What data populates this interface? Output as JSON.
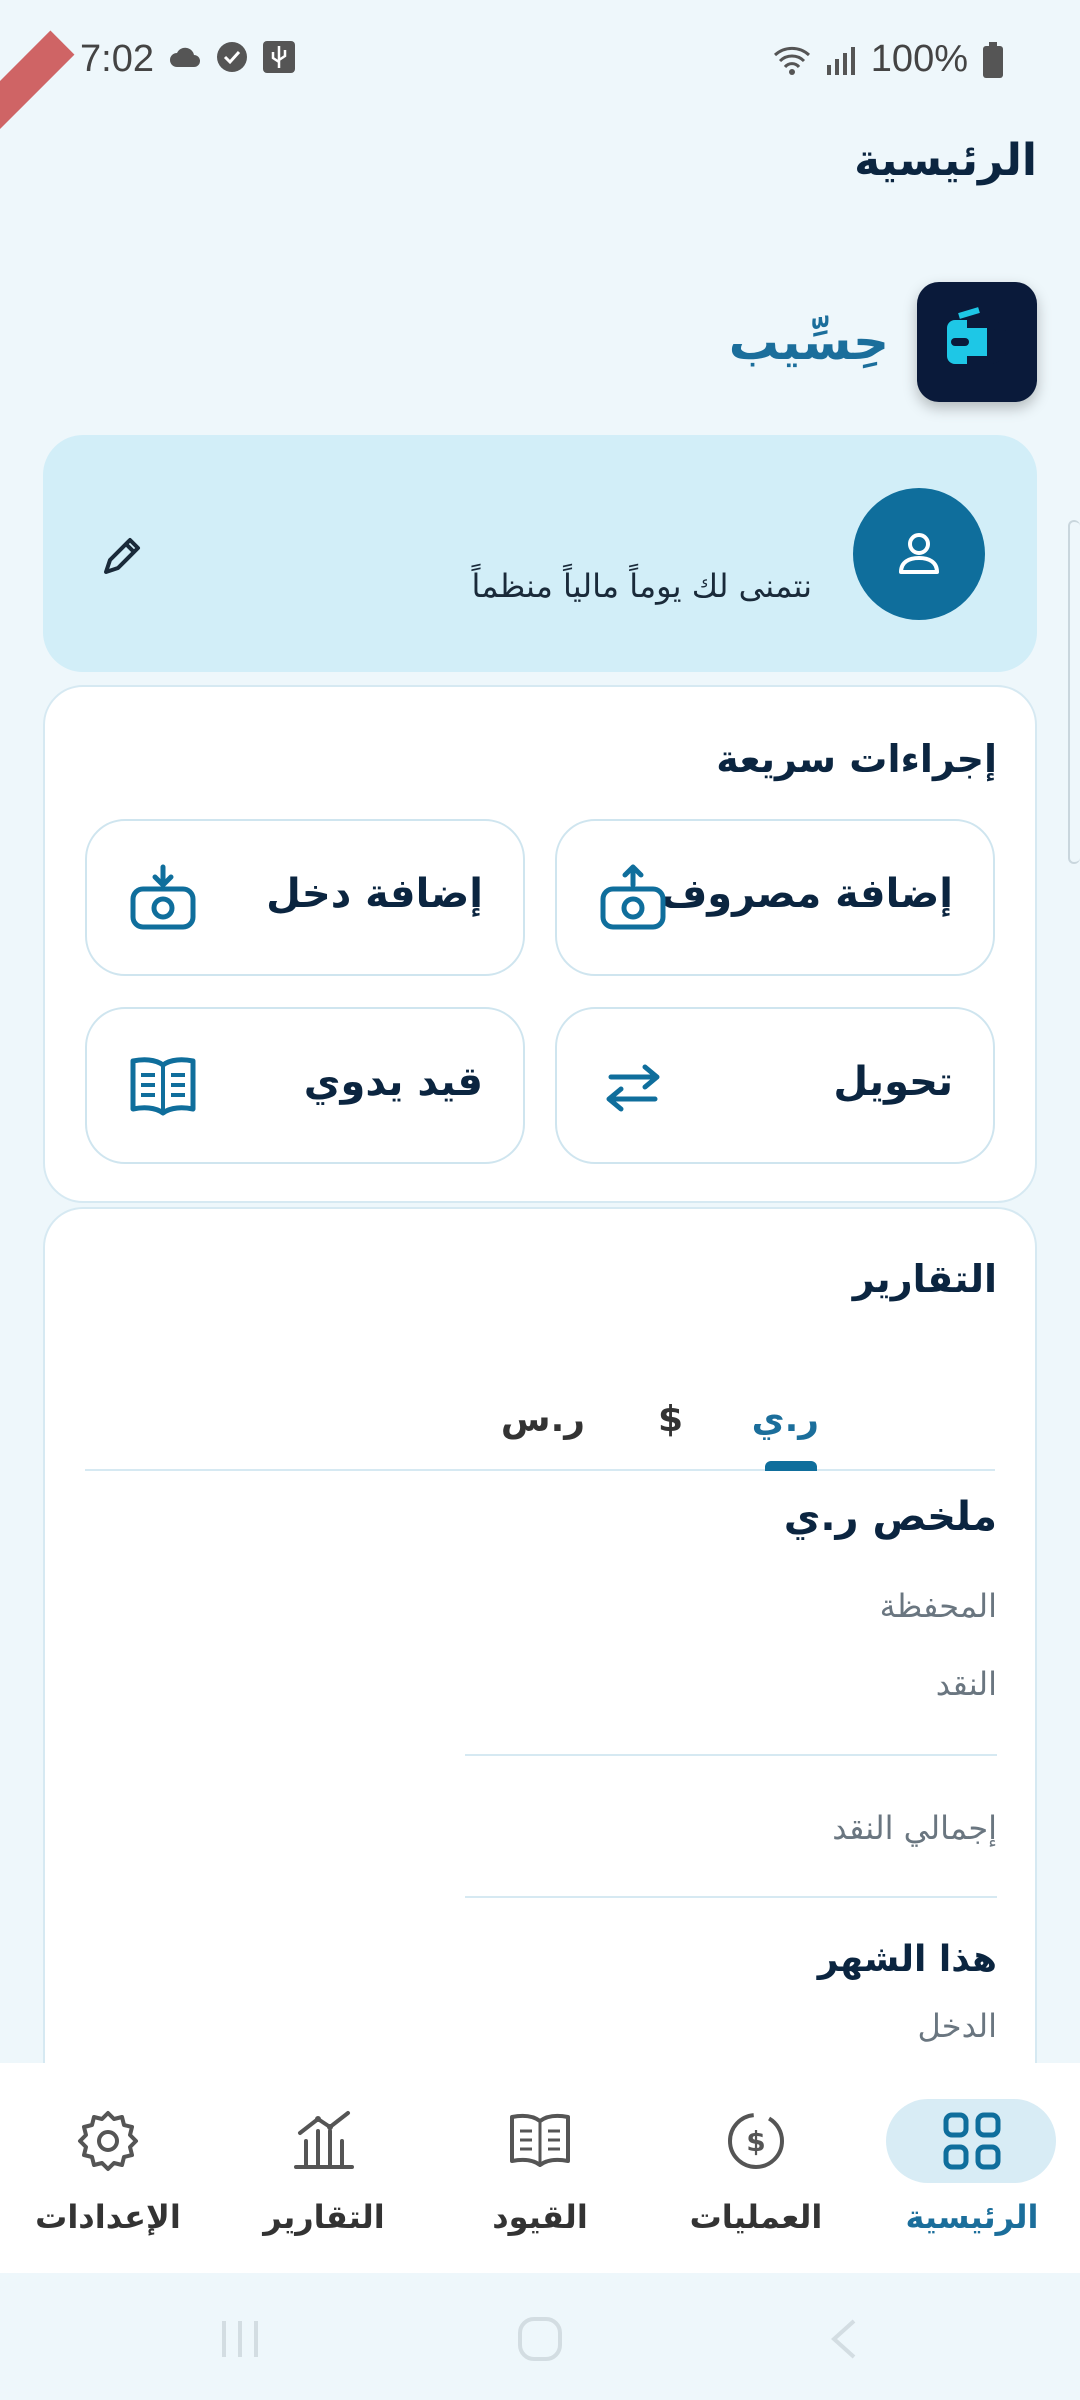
{
  "status_bar": {
    "time": "7:02",
    "battery": "100%"
  },
  "header": {
    "title": "الرئيسية"
  },
  "brand": {
    "name": "حِسِّيب"
  },
  "greeting": {
    "text": "نتمنى لك يوماً مالياً منظماً"
  },
  "quick_actions": {
    "title": "إجراءات سريعة",
    "add_expense": "إضافة مصروف",
    "add_income": "إضافة دخل",
    "transfer": "تحويل",
    "manual_entry": "قيد يدوي"
  },
  "reports": {
    "title": "التقارير",
    "tabs": [
      "ر.ي",
      "$",
      "ر.س"
    ],
    "active_tab": "ر.ي",
    "summary_title": "ملخص ر.ي",
    "rows": [
      "المحفظة",
      "النقد"
    ],
    "total_label": "إجمالي النقد",
    "month_title": "هذا الشهر",
    "month_rows": [
      "الدخل"
    ]
  },
  "bottom_nav": {
    "home": "الرئيسية",
    "transactions": "العمليات",
    "entries": "القيود",
    "reports": "التقارير",
    "settings": "الإعدادات"
  },
  "colors": {
    "accent": "#0f6e9c",
    "greeting_bg": "#d2eef8",
    "page_bg": "#eef7fb"
  },
  "icons": [
    "cloud-icon",
    "check-circle-icon",
    "usb-icon",
    "wifi-icon",
    "signal-icon",
    "battery-icon",
    "user-icon",
    "pencil-icon",
    "money-up-icon",
    "money-down-icon",
    "transfer-arrows-icon",
    "book-icon",
    "grid-icon",
    "dollar-circle-icon",
    "chart-icon",
    "gear-icon"
  ]
}
